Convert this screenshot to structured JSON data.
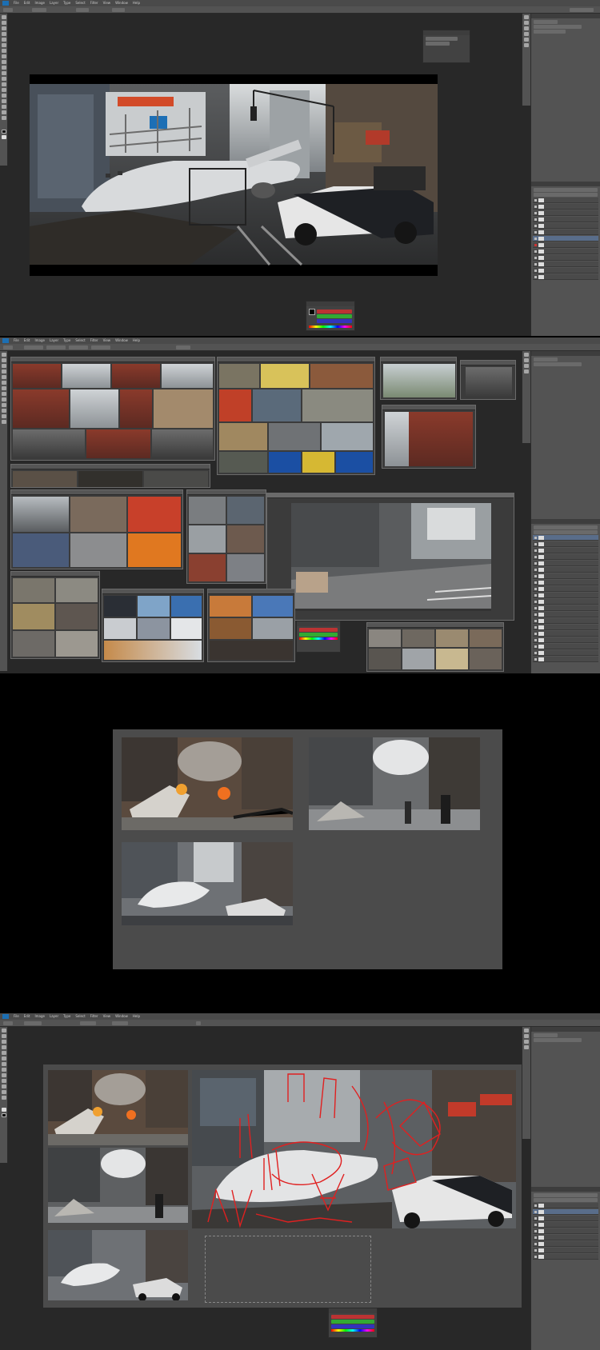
{
  "app": {
    "logo": "Ps",
    "menu": [
      "File",
      "Edit",
      "Image",
      "Layer",
      "Type",
      "Select",
      "Filter",
      "View",
      "Window",
      "Help"
    ]
  },
  "icons": {
    "eye": "eye-icon",
    "layer_thumb": "layer-thumbnail-icon",
    "collapse": "collapse-arrows-icon"
  },
  "colors": {
    "ui_dark": "#282828",
    "ui_panel": "#535353",
    "ui_selected_layer": "#596d8a",
    "ps_blue": "#1c6fb3",
    "sketch_red": "#e02020"
  }
}
